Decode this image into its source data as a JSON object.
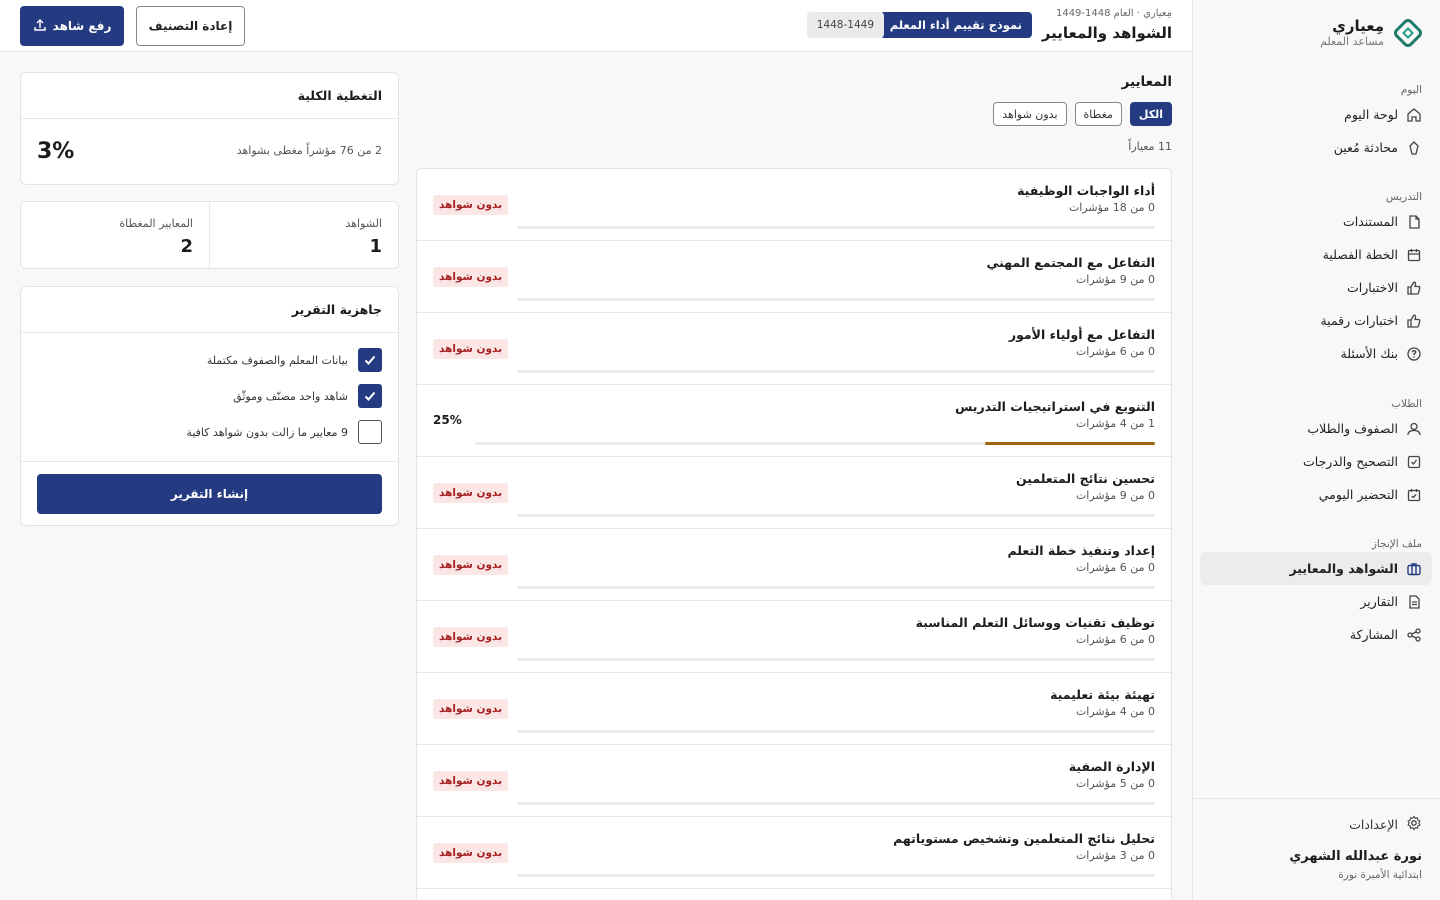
{
  "brand": {
    "name": "مِعياري",
    "subtitle": "مساعد المعلم"
  },
  "sidebar": {
    "sections": [
      {
        "title": "اليوم",
        "items": [
          {
            "label": "لوحة اليوم",
            "icon": "home-icon"
          },
          {
            "label": "محادثة مُعين",
            "icon": "sparkle-icon"
          }
        ]
      },
      {
        "title": "التدريس",
        "items": [
          {
            "label": "المستندات",
            "icon": "document-icon"
          },
          {
            "label": "الخطة الفصلية",
            "icon": "calendar-icon"
          },
          {
            "label": "الاختبارات",
            "icon": "thumbs-up-icon"
          },
          {
            "label": "اختبارات رقمية",
            "icon": "thumbs-up-icon"
          },
          {
            "label": "بنك الأسئلة",
            "icon": "question-circle-icon"
          }
        ]
      },
      {
        "title": "الطلاب",
        "items": [
          {
            "label": "الصفوف والطلاب",
            "icon": "user-icon"
          },
          {
            "label": "التصحيح والدرجات",
            "icon": "check-square-icon"
          },
          {
            "label": "التحضير اليومي",
            "icon": "calendar-check-icon"
          }
        ]
      },
      {
        "title": "ملف الإنجاز",
        "items": [
          {
            "label": "الشواهد والمعايير",
            "icon": "briefcase-icon",
            "active": true
          },
          {
            "label": "التقارير",
            "icon": "file-text-icon"
          },
          {
            "label": "المشاركة",
            "icon": "share-icon"
          }
        ]
      }
    ],
    "settings_label": "الإعدادات",
    "user_name": "نورة عبدالله الشهري",
    "user_school": "ابتدائية الأميرة نورة"
  },
  "header": {
    "meta": "مِعياري · العام 1448-1449",
    "title": "الشواهد والمعايير",
    "form_badge": "نموذج تقييم أداء المعلم",
    "year_badge": "1448-1449",
    "reclassify_label": "إعادة التصنيف",
    "upload_label": "رفع شاهد"
  },
  "criteria": {
    "title": "المعايير",
    "filters": [
      {
        "label": "الكل",
        "active": true
      },
      {
        "label": "مغطاة",
        "active": false
      },
      {
        "label": "بدون شواهد",
        "active": false
      }
    ],
    "count_label": "11 معياراً",
    "no_evidence_label": "بدون شواهد",
    "items": [
      {
        "name": "أداء الواجبات الوظيفية",
        "sub": "0 من 18 مؤشرات",
        "progress": 0
      },
      {
        "name": "التفاعل مع المجتمع المهني",
        "sub": "0 من 9 مؤشرات",
        "progress": 0
      },
      {
        "name": "التفاعل مع أولياء الأمور",
        "sub": "0 من 6 مؤشرات",
        "progress": 0
      },
      {
        "name": "التنويع في استراتيجيات التدريس",
        "sub": "1 من 4 مؤشرات",
        "progress": 0.25,
        "percent_label": "25%"
      },
      {
        "name": "تحسين نتائج المتعلمين",
        "sub": "0 من 9 مؤشرات",
        "progress": 0
      },
      {
        "name": "إعداد وتنفيذ خطة التعلم",
        "sub": "0 من 6 مؤشرات",
        "progress": 0
      },
      {
        "name": "توظيف تقنيات ووسائل التعلم المناسبة",
        "sub": "0 من 6 مؤشرات",
        "progress": 0
      },
      {
        "name": "تهيئة بيئة تعليمية",
        "sub": "0 من 4 مؤشرات",
        "progress": 0
      },
      {
        "name": "الإدارة الصفية",
        "sub": "0 من 5 مؤشرات",
        "progress": 0
      },
      {
        "name": "تحليل نتائج المتعلمين وتشخيص مستوياتهم",
        "sub": "0 من 3 مؤشرات",
        "progress": 0
      }
    ]
  },
  "coverage": {
    "title": "التغطية الكلية",
    "description": "2 من 76 مؤشراً مغطى بشواهد",
    "percent": "3%"
  },
  "stats": {
    "evidence_label": "الشواهد",
    "evidence_value": "1",
    "covered_label": "المعايير المغطاة",
    "covered_value": "2"
  },
  "readiness": {
    "title": "جاهزية التقرير",
    "checks": [
      {
        "label": "بيانات المعلم والصفوف مكتملة",
        "checked": true
      },
      {
        "label": "شاهد واحد مصنّف وموثّق",
        "checked": true
      },
      {
        "label": "9 معايير ما زالت بدون شواهد كافية",
        "checked": false
      }
    ],
    "button_label": "إنشاء التقرير"
  },
  "colors": {
    "primary": "#243b82",
    "progress_fill": "#a0640e",
    "status_bg": "#fbe6e6",
    "status_text": "#a52020"
  }
}
